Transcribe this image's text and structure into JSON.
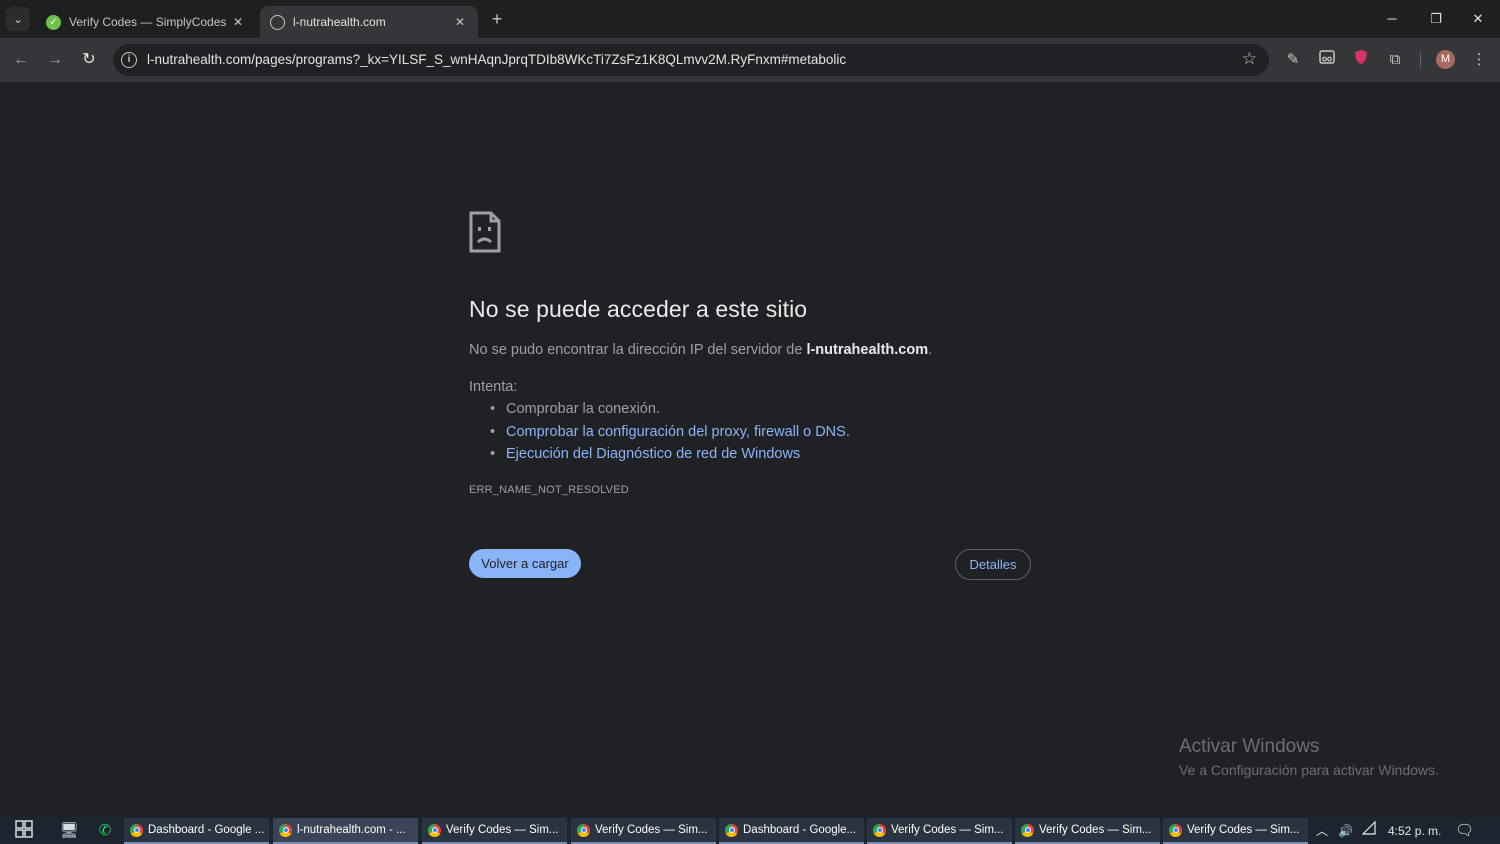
{
  "tabs": [
    {
      "title": "Verify Codes — SimplyCodes",
      "favicon": "simplycodes-icon",
      "active": false
    },
    {
      "title": "l-nutrahealth.com",
      "favicon": "globe-icon",
      "active": true
    }
  ],
  "address_bar": {
    "url": "l-nutrahealth.com/pages/programs?_kx=YILSF_S_wnHAqnJprqTDIb8WKcTi7ZsFz1K8QLmvv2M.RyFnxm#metabolic"
  },
  "profile": {
    "initial": "M"
  },
  "error_page": {
    "title": "No se puede acceder a este sitio",
    "description_prefix": "No se pudo encontrar la dirección IP del servidor de ",
    "domain": "l-nutrahealth.com",
    "description_suffix": ".",
    "try_label": "Intenta:",
    "suggestions": [
      "Comprobar la conexión.",
      "Comprobar la configuración del proxy, firewall o DNS.",
      "Ejecución del Diagnóstico de red de Windows"
    ],
    "error_code": "ERR_NAME_NOT_RESOLVED",
    "reload_label": "Volver a cargar",
    "details_label": "Detalles"
  },
  "watermark": {
    "title": "Activar Windows",
    "subtitle": "Ve a Configuración para activar Windows."
  },
  "taskbar": {
    "items": [
      {
        "label": "Dashboard - Google ...",
        "active": false
      },
      {
        "label": "l-nutrahealth.com - ...",
        "active": true
      },
      {
        "label": "Verify Codes — Sim...",
        "active": false
      },
      {
        "label": "Verify Codes — Sim...",
        "active": false
      },
      {
        "label": "Dashboard - Google...",
        "active": false
      },
      {
        "label": "Verify Codes — Sim...",
        "active": false
      },
      {
        "label": "Verify Codes — Sim...",
        "active": false
      },
      {
        "label": "Verify Codes — Sim...",
        "active": false
      }
    ],
    "clock": "4:52 p. m."
  },
  "colors": {
    "page_bg": "#202124",
    "link": "#8ab4f8",
    "title_text": "#e8eaed",
    "body_text": "#9aa0a6"
  }
}
